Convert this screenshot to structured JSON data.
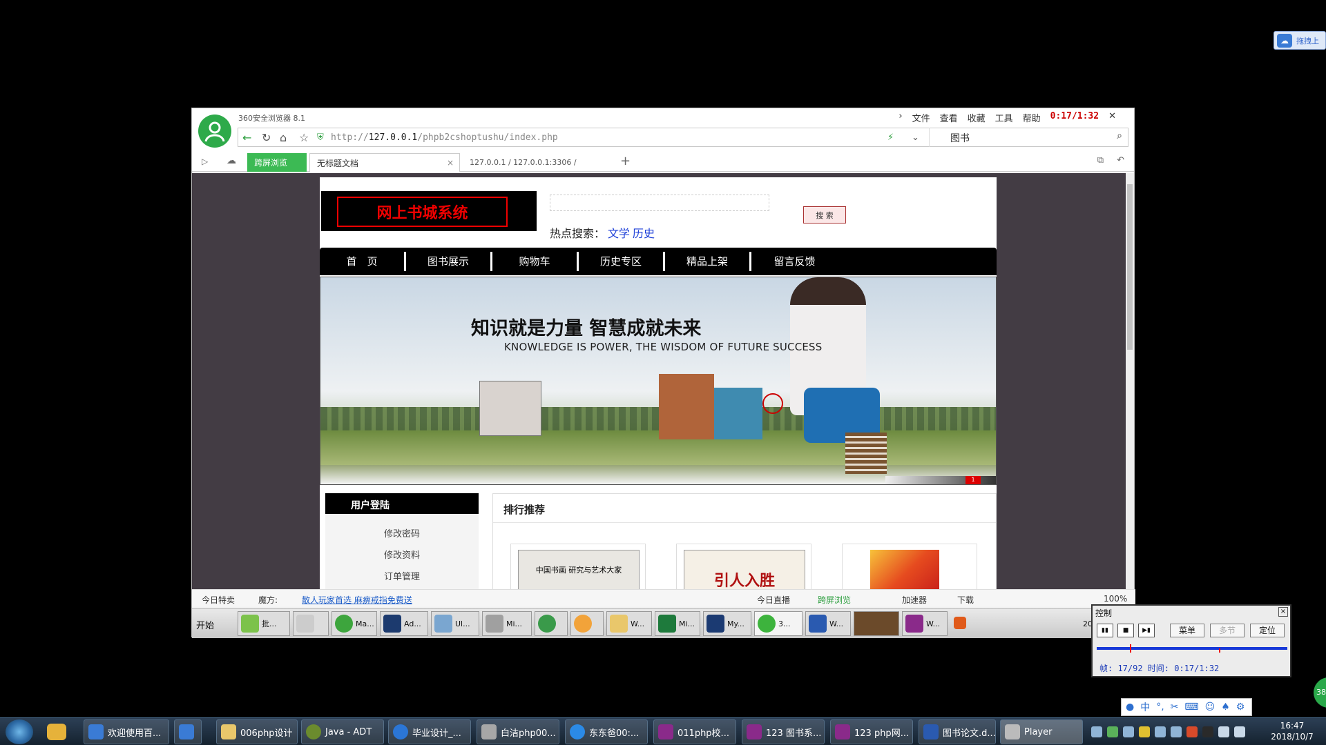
{
  "cloud_float": {
    "text": "拖拽上"
  },
  "browser": {
    "app_name": "360安全浏览器 8.1",
    "menu": [
      "文件",
      "查看",
      "收藏",
      "工具",
      "帮助"
    ],
    "recording_time": "0:17/1:32",
    "url_prefix": "http://",
    "url_host": "127.0.0.1",
    "url_path": "/phpb2cshoptushu/index.php",
    "search_value": "图书",
    "tabs": {
      "green": "跨屏浏览",
      "active": "无标题文档",
      "pma": "127.0.0.1 / 127.0.0.1:3306 /"
    }
  },
  "site": {
    "logo": "网上书城系统",
    "search_button": "搜 索",
    "hot_label": "热点搜索：",
    "hot_links": [
      "文学",
      "历史"
    ],
    "nav": [
      "首　页",
      "图书展示",
      "购物车",
      "历史专区",
      "精品上架",
      "留言反馈"
    ],
    "banner": {
      "slogan": "知识就是力量 智慧成就未来",
      "sub": "KNOWLEDGE IS POWER, THE WISDOM OF FUTURE SUCCESS",
      "page": "1"
    },
    "login": {
      "title": "用户登陆",
      "links": [
        "修改密码",
        "修改资料",
        "订单管理"
      ]
    },
    "rank": {
      "title": "排行推荐",
      "books": [
        "中国书画 研究与艺术大家",
        "引人入胜",
        ""
      ]
    }
  },
  "statusbar": {
    "today_sale": "今日特卖",
    "magic": "魔方:",
    "link": "散人玩家首选 麻痹戒指免费送",
    "live": "今日直播",
    "cross": "跨屏浏览",
    "accelerate": "加速器",
    "download": "下载",
    "zoom": "100%"
  },
  "xp_taskbar": {
    "start": "开始",
    "items": [
      "批...",
      "",
      "Ma...",
      "Ad...",
      "Ul...",
      "Mi...",
      "",
      "",
      "W...",
      "Mi...",
      "My...",
      "3...",
      "W...",
      "",
      "W..."
    ],
    "clock_prefix": "20"
  },
  "player": {
    "title": "控制",
    "menu": "菜单",
    "multi": "多节",
    "locate": "定位",
    "info": "帧: 17/92 时间: 0:17/1:32"
  },
  "green_badge": "38",
  "win_taskbar": {
    "items": [
      "欢迎使用百...",
      "",
      "006php设计",
      "Java - ADT",
      "毕业设计_...",
      "白洁php00...",
      "东东爸00:...",
      "011php校...",
      "123 图书系...",
      "123 php网...",
      "图书论文.d...",
      "Player"
    ],
    "time": "16:47",
    "date": "2018/10/7"
  }
}
